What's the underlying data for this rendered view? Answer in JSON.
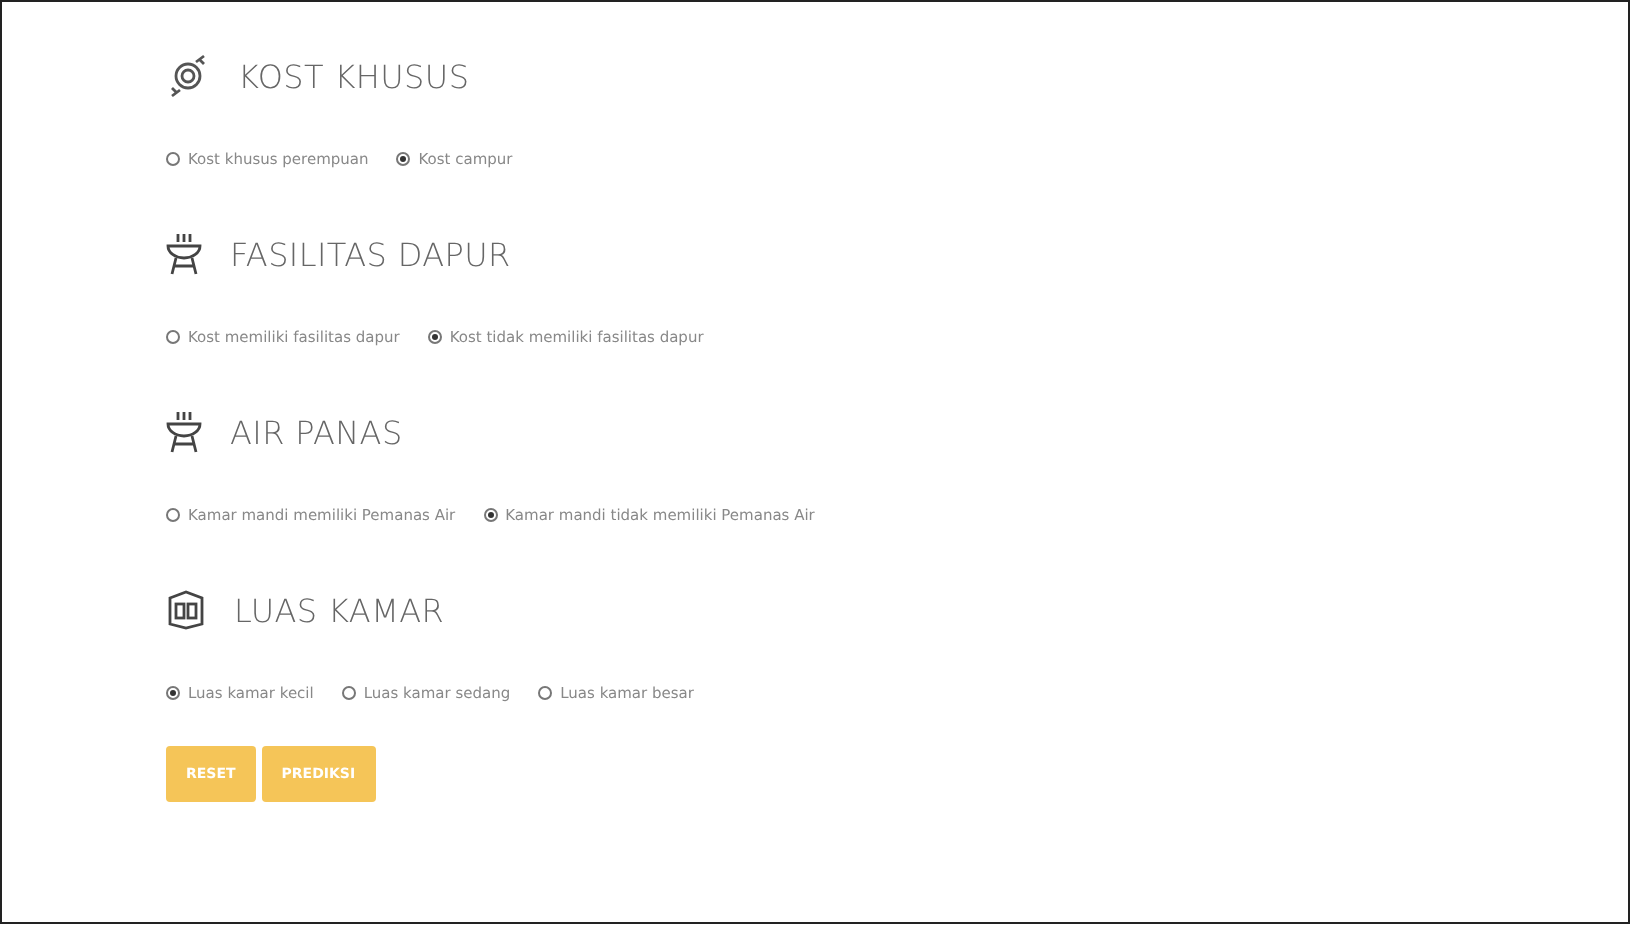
{
  "sections": [
    {
      "title": "KOST KHUSUS",
      "options": [
        {
          "label": "Kost khusus perempuan",
          "selected": false
        },
        {
          "label": "Kost campur",
          "selected": true
        }
      ]
    },
    {
      "title": "FASILITAS DAPUR",
      "options": [
        {
          "label": "Kost memiliki fasilitas dapur",
          "selected": false
        },
        {
          "label": "Kost tidak memiliki fasilitas dapur",
          "selected": true
        }
      ]
    },
    {
      "title": "AIR PANAS",
      "options": [
        {
          "label": "Kamar mandi memiliki Pemanas Air",
          "selected": false
        },
        {
          "label": "Kamar mandi tidak memiliki Pemanas Air",
          "selected": true
        }
      ]
    },
    {
      "title": "LUAS KAMAR",
      "options": [
        {
          "label": "Luas kamar kecil",
          "selected": true
        },
        {
          "label": "Luas kamar sedang",
          "selected": false
        },
        {
          "label": "Luas kamar besar",
          "selected": false
        }
      ]
    }
  ],
  "buttons": [
    {
      "label": "RESET"
    },
    {
      "label": "PREDIKSI"
    }
  ]
}
